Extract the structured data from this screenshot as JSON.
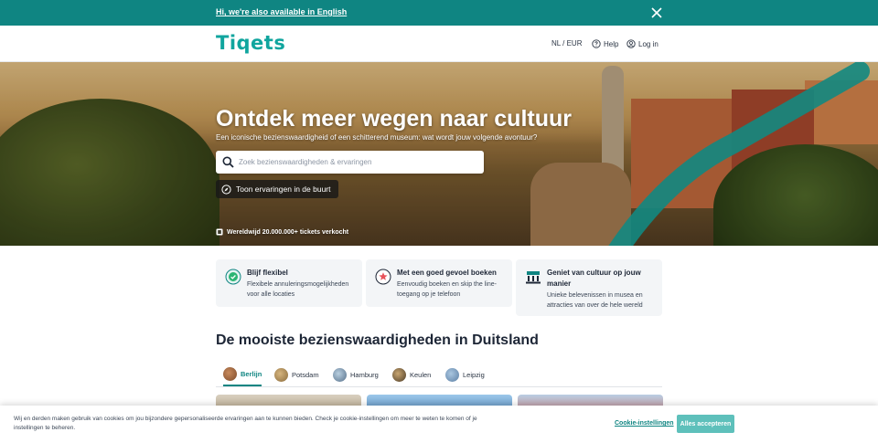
{
  "banner": {
    "link_text": "Hi, we're also available in English",
    "close_icon": "close-icon"
  },
  "header": {
    "logo": "Tiqets",
    "language_currency": "NL / EUR",
    "help": "Help",
    "login": "Log in"
  },
  "hero": {
    "title": "Ontdek meer wegen naar cultuur",
    "subtitle": "Een iconische bezienswaardigheid of een schitterend museum: wat wordt jouw volgende avontuur?",
    "search_placeholder": "Zoek bezienswaardigheden & ervaringen",
    "nearby_button": "Toon ervaringen in de buurt",
    "tickets_sold": "Wereldwijd 20.000.000+ tickets verkocht"
  },
  "features": [
    {
      "title": "Blijf flexibel",
      "description": "Flexibele annuleringsmogelijkheden voor alle locaties",
      "icon": "calendar-check-icon"
    },
    {
      "title": "Met een goed gevoel boeken",
      "description": "Eenvoudig boeken en skip the line-toegang op je telefoon",
      "icon": "ticket-star-icon"
    },
    {
      "title": "Geniet van cultuur op jouw manier",
      "description": "Unieke belevenissen in musea en attracties van over de hele wereld",
      "icon": "museum-icon"
    }
  ],
  "section": {
    "title": "De mooiste bezienswaardigheden in Duitsland",
    "tabs": [
      {
        "label": "Berlijn",
        "active": true
      },
      {
        "label": "Potsdam",
        "active": false
      },
      {
        "label": "Hamburg",
        "active": false
      },
      {
        "label": "Keulen",
        "active": false
      },
      {
        "label": "Leipzig",
        "active": false
      }
    ]
  },
  "cookie": {
    "text": "Wij en derden maken gebruik van cookies om jou bijzondere gepersonaliseerde ervaringen aan te kunnen bieden. Check je cookie-instellingen om meer te weten te komen of je instellingen te beheren.",
    "settings_link": "Cookie-instellingen",
    "accept_button": "Alles accepteren"
  },
  "colors": {
    "brand": "#0f8582",
    "logo": "#10a59e",
    "accept": "#5ec0bb"
  }
}
